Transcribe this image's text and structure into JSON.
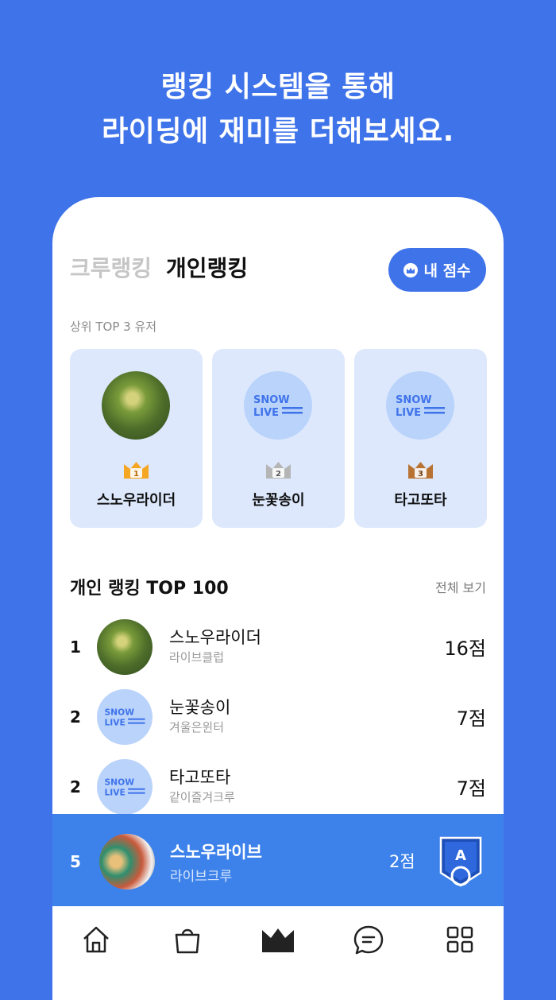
{
  "headline": {
    "line1": "랭킹 시스템을 통해",
    "line2": "라이딩에 재미를 더해보세요."
  },
  "tabs": [
    {
      "label": "크루랭킹",
      "active": false
    },
    {
      "label": "개인랭킹",
      "active": true
    }
  ],
  "my_score_button": {
    "label": "내 점수",
    "icon": "crown-circle-icon"
  },
  "top3": {
    "caption": "상위 TOP 3 유저",
    "users": [
      {
        "rank": "1",
        "name": "스노우라이더",
        "avatar": "leaf-photo",
        "crown_color": "#f5a623"
      },
      {
        "rank": "2",
        "name": "눈꽃송이",
        "avatar": "snowlive-logo",
        "crown_color": "#b5b5b5"
      },
      {
        "rank": "3",
        "name": "타고또타",
        "avatar": "snowlive-logo",
        "crown_color": "#b87333"
      }
    ]
  },
  "ranking": {
    "title": "개인 랭킹 TOP 100",
    "view_all": "전체 보기",
    "rows": [
      {
        "rank": "1",
        "name": "스노우라이더",
        "crew": "라이브클럽",
        "score": "16점",
        "avatar": "leaf-photo"
      },
      {
        "rank": "2",
        "name": "눈꽃송이",
        "crew": "겨울은윈터",
        "score": "7점",
        "avatar": "snowlive-logo"
      },
      {
        "rank": "2",
        "name": "타고또타",
        "crew": "같이즐겨크루",
        "score": "7점",
        "avatar": "snowlive-logo"
      }
    ]
  },
  "my_rank": {
    "rank": "5",
    "name": "스노우라이브",
    "crew": "라이브크루",
    "score": "2점",
    "badge_letter": "A",
    "badge_icon": "tier-shield-icon"
  },
  "bottom_nav": [
    {
      "icon": "home-icon"
    },
    {
      "icon": "shopping-bag-icon"
    },
    {
      "icon": "crown-icon",
      "active": true
    },
    {
      "icon": "chat-bubble-icon"
    },
    {
      "icon": "grid-icon"
    }
  ],
  "colors": {
    "brand_blue": "#3f73ea",
    "card_bg": "#dde8fd",
    "my_bar_bg": "#3d82ea"
  },
  "logo_text": {
    "line1": "SNOW",
    "line2": "LIVE"
  }
}
